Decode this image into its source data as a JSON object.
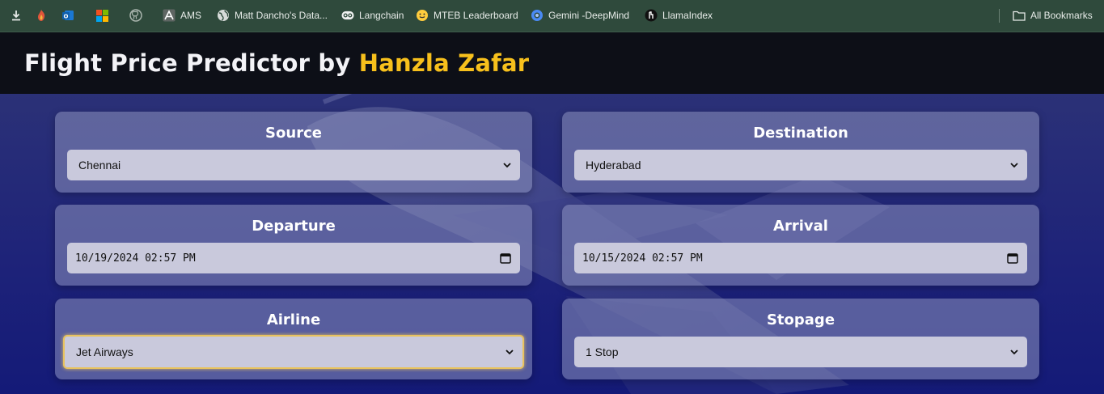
{
  "bookmarks": {
    "items": [
      {
        "label": "AMS",
        "icon": "ams-icon"
      },
      {
        "label": "Matt Dancho's Data...",
        "icon": "globe-icon"
      },
      {
        "label": "Langchain",
        "icon": "langchain-icon"
      },
      {
        "label": "MTEB Leaderboard",
        "icon": "huggingface-icon"
      },
      {
        "label": "Gemini -DeepMind",
        "icon": "gemini-icon"
      },
      {
        "label": "LlamaIndex",
        "icon": "llama-icon"
      }
    ],
    "all_bookmarks": "All Bookmarks"
  },
  "header": {
    "title_main": "Flight Price Predictor by ",
    "title_accent": "Hanzla Zafar"
  },
  "form": {
    "source": {
      "label": "Source",
      "value": "Chennai"
    },
    "destination": {
      "label": "Destination",
      "value": "Hyderabad"
    },
    "departure": {
      "label": "Departure",
      "value": "10/19/2024 02:57 PM"
    },
    "arrival": {
      "label": "Arrival",
      "value": "10/15/2024 02:57 PM"
    },
    "airline": {
      "label": "Airline",
      "value": "Jet Airways"
    },
    "stopage": {
      "label": "Stopage",
      "value": "1 Stop"
    }
  },
  "colors": {
    "accent": "#f7c01c",
    "header_bg": "#0d0f17",
    "bookmarks_bg": "#2f4a3c"
  }
}
